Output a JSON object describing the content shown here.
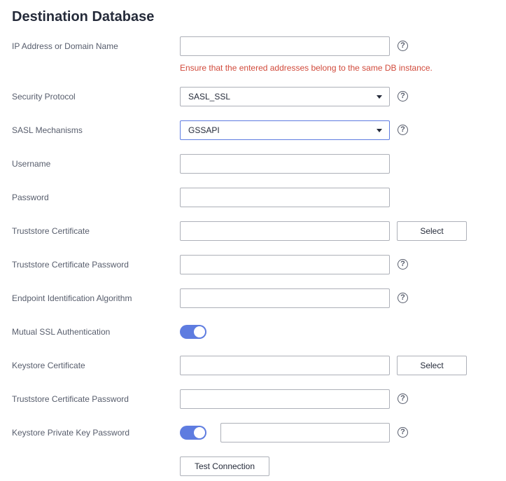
{
  "title": "Destination Database",
  "fields": {
    "ip": {
      "label": "IP Address or Domain Name",
      "value": "",
      "error": "Ensure that the entered addresses belong to the same DB instance."
    },
    "security_protocol": {
      "label": "Security Protocol",
      "value": "SASL_SSL"
    },
    "sasl_mechanisms": {
      "label": "SASL Mechanisms",
      "value": "GSSAPI"
    },
    "username": {
      "label": "Username",
      "value": ""
    },
    "password": {
      "label": "Password",
      "value": ""
    },
    "truststore_cert": {
      "label": "Truststore Certificate",
      "value": "",
      "button": "Select"
    },
    "truststore_cert_password": {
      "label": "Truststore Certificate Password",
      "value": ""
    },
    "endpoint_algorithm": {
      "label": "Endpoint Identification Algorithm",
      "value": ""
    },
    "mutual_ssl": {
      "label": "Mutual SSL Authentication",
      "enabled": true
    },
    "keystore_cert": {
      "label": "Keystore Certificate",
      "value": "",
      "button": "Select"
    },
    "truststore_cert_password_2": {
      "label": "Truststore Certificate Password",
      "value": ""
    },
    "keystore_key_password": {
      "label": "Keystore Private Key Password",
      "enabled": true,
      "value": ""
    }
  },
  "help_icon": "?",
  "test_connection_label": "Test Connection",
  "colors": {
    "accent": "#5e7ce0",
    "error": "#d14a3b",
    "border": "#adb0b8"
  }
}
